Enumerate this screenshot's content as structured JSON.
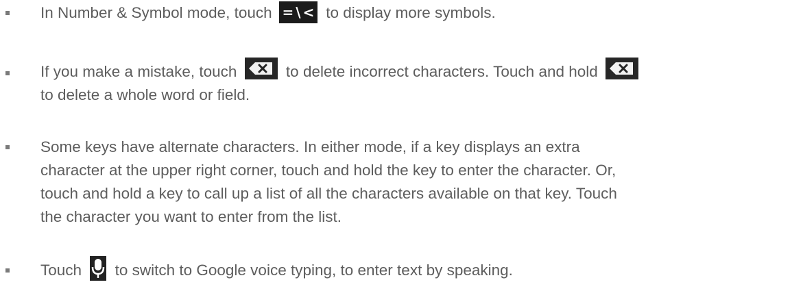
{
  "items": [
    {
      "parts": {
        "a": "In Number & Symbol mode, touch",
        "icon": "symbols-key-icon",
        "icon_glyphs": [
          "=",
          "\\",
          "<"
        ],
        "b": "to display more symbols."
      }
    },
    {
      "parts": {
        "a": "If you make a mistake, touch",
        "icon1": "delete-key-icon",
        "b": "to delete incorrect characters. Touch and hold",
        "icon2": "delete-key-icon",
        "c": "to delete a whole word or field."
      }
    },
    {
      "lines": [
        "Some keys have alternate characters. In either mode, if a key displays an extra",
        "character at the upper right corner, touch and hold the key to enter the character. Or,",
        "touch and hold a key to call up a list of all the characters available on that key. Touch",
        "the character you want to enter from the list."
      ]
    },
    {
      "parts": {
        "a": "Touch",
        "icon": "microphone-icon",
        "b": "to switch to Google voice typing, to enter text by speaking."
      }
    }
  ],
  "colors": {
    "text": "#5d5d5d",
    "bullet": "#7a7a7a",
    "icon_background": "#1b1b1b"
  }
}
